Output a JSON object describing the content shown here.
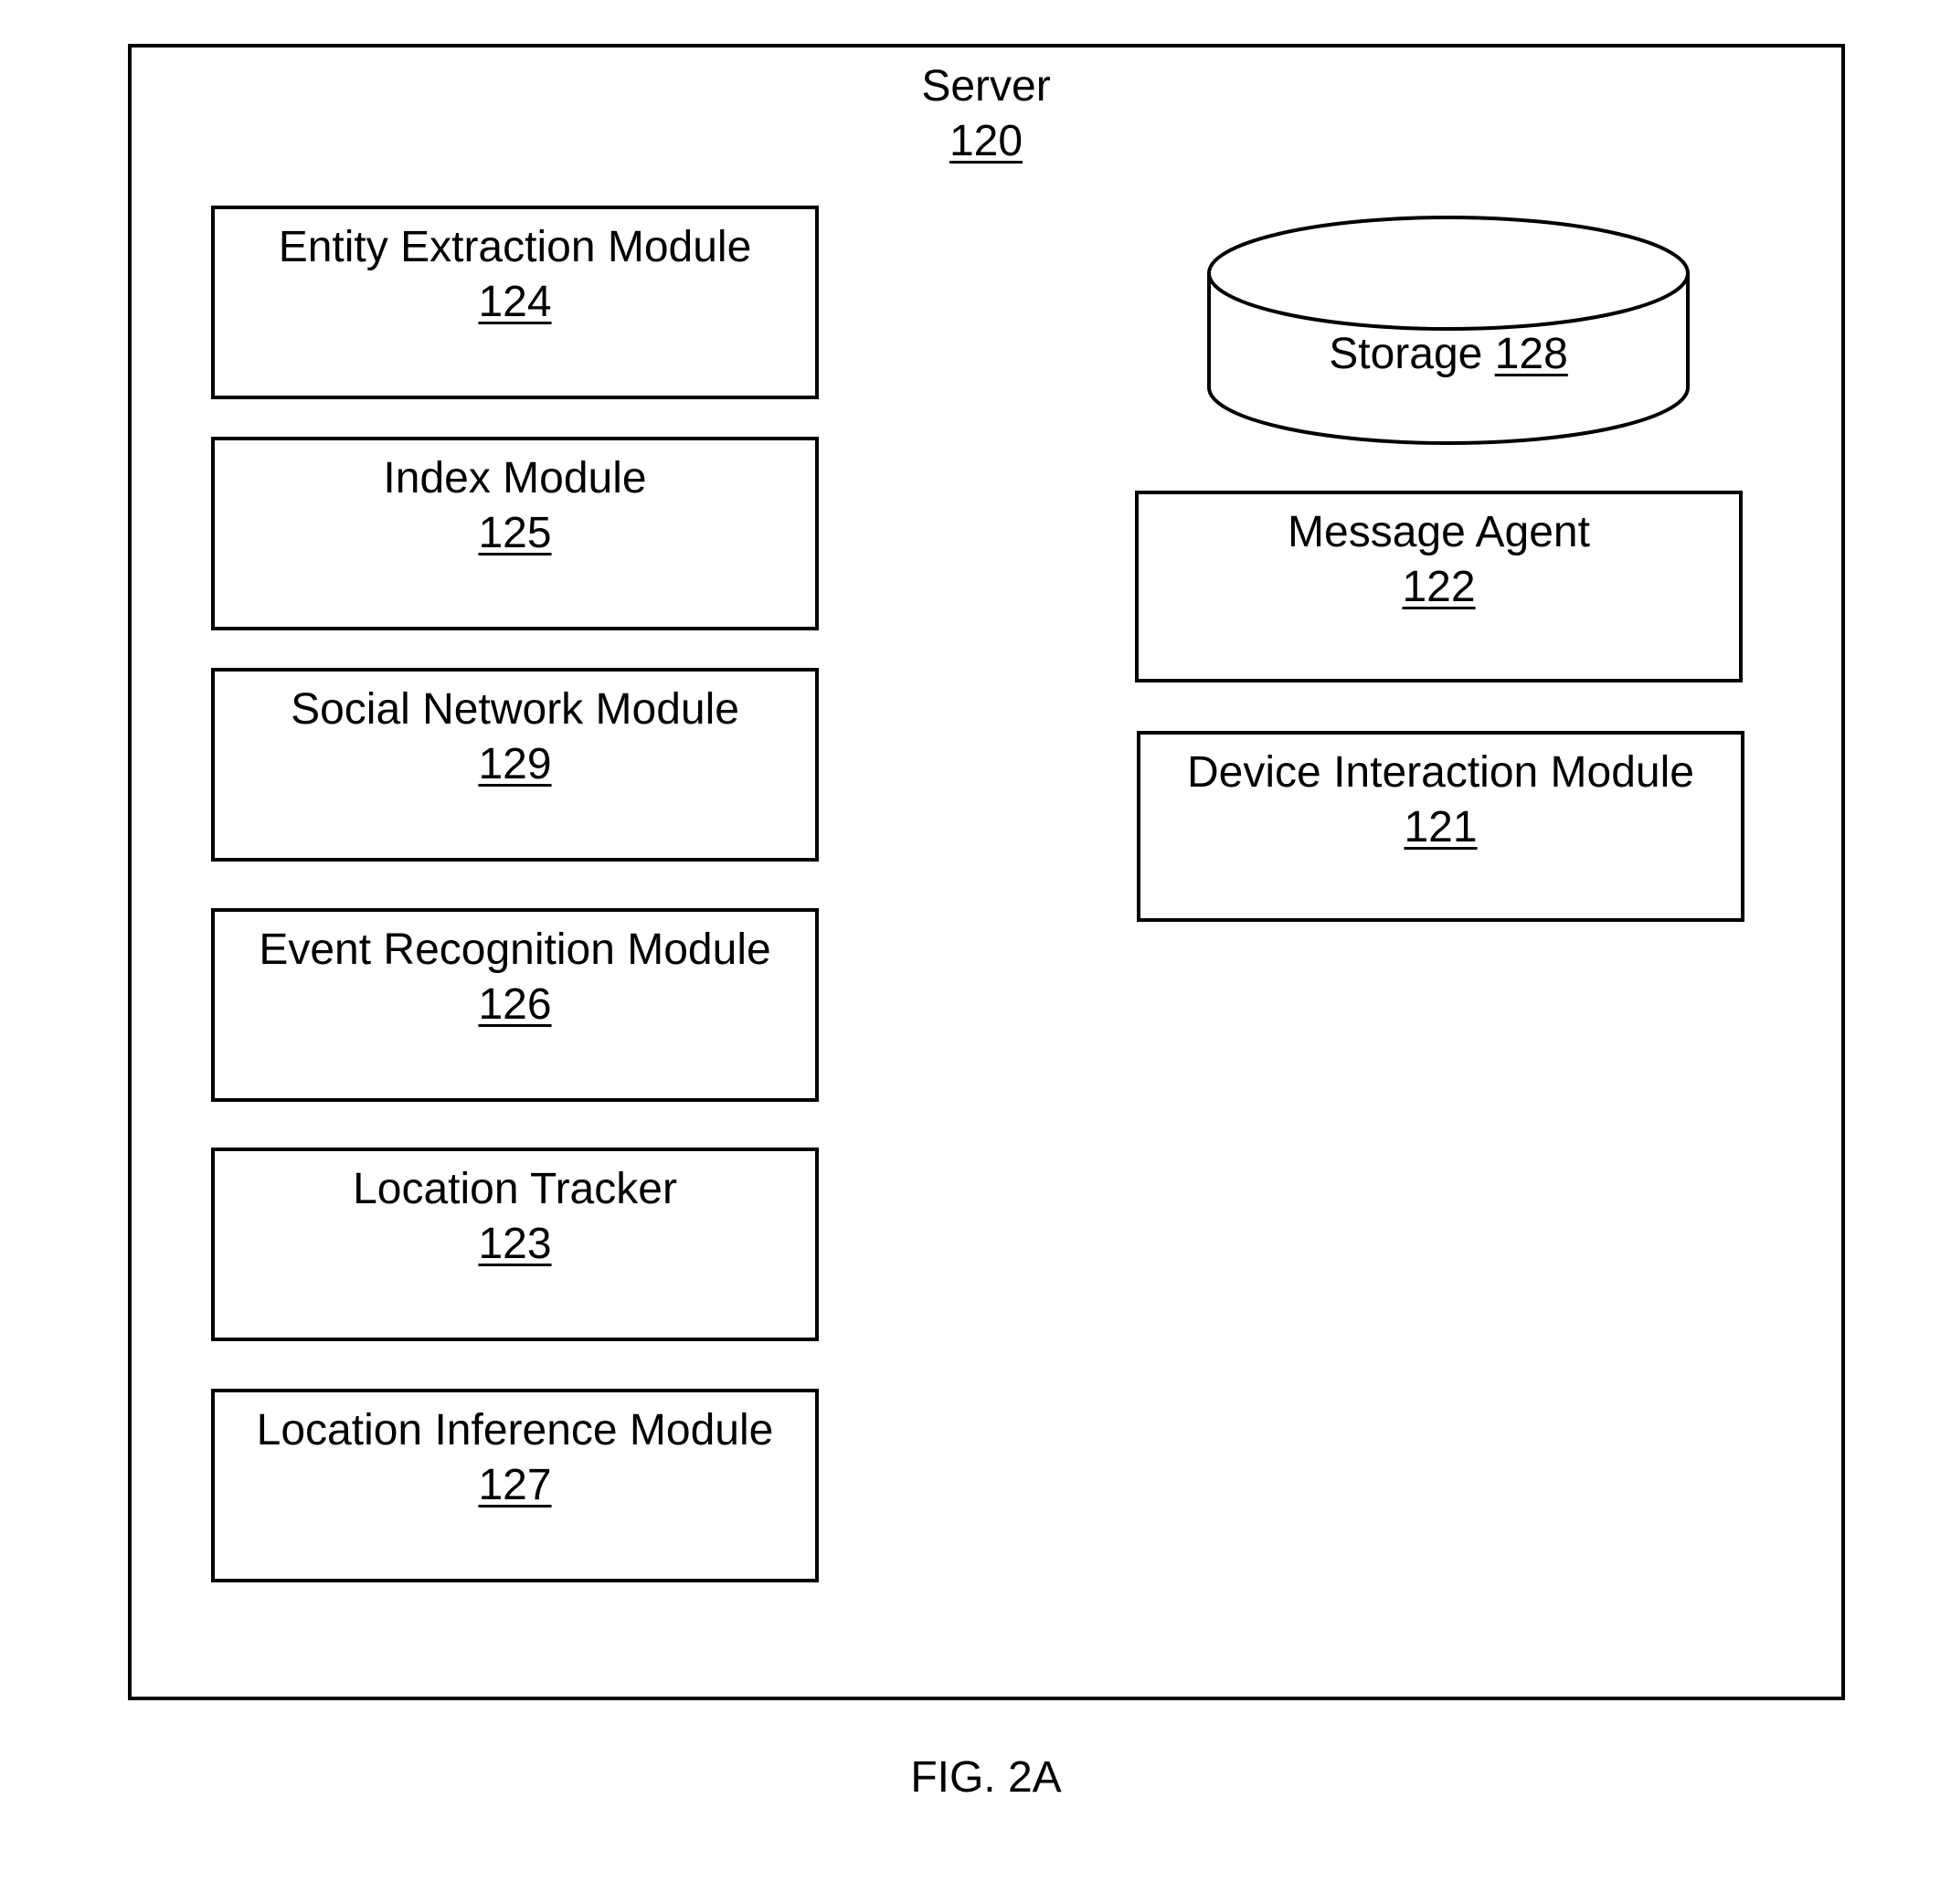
{
  "server": {
    "title": "Server",
    "ref": "120"
  },
  "left_modules": [
    {
      "name": "Entity Extraction Module",
      "ref": "124"
    },
    {
      "name": "Index Module",
      "ref": "125"
    },
    {
      "name": "Social Network Module",
      "ref": "129"
    },
    {
      "name": "Event Recognition Module",
      "ref": "126"
    },
    {
      "name": "Location Tracker",
      "ref": "123"
    },
    {
      "name": "Location Inference Module",
      "ref": "127"
    }
  ],
  "storage": {
    "name": "Storage",
    "ref": "128"
  },
  "right_modules": [
    {
      "name": "Message Agent",
      "ref": "122"
    },
    {
      "name": "Device Interaction Module",
      "ref": "121"
    }
  ],
  "figure_label": "FIG. 2A"
}
